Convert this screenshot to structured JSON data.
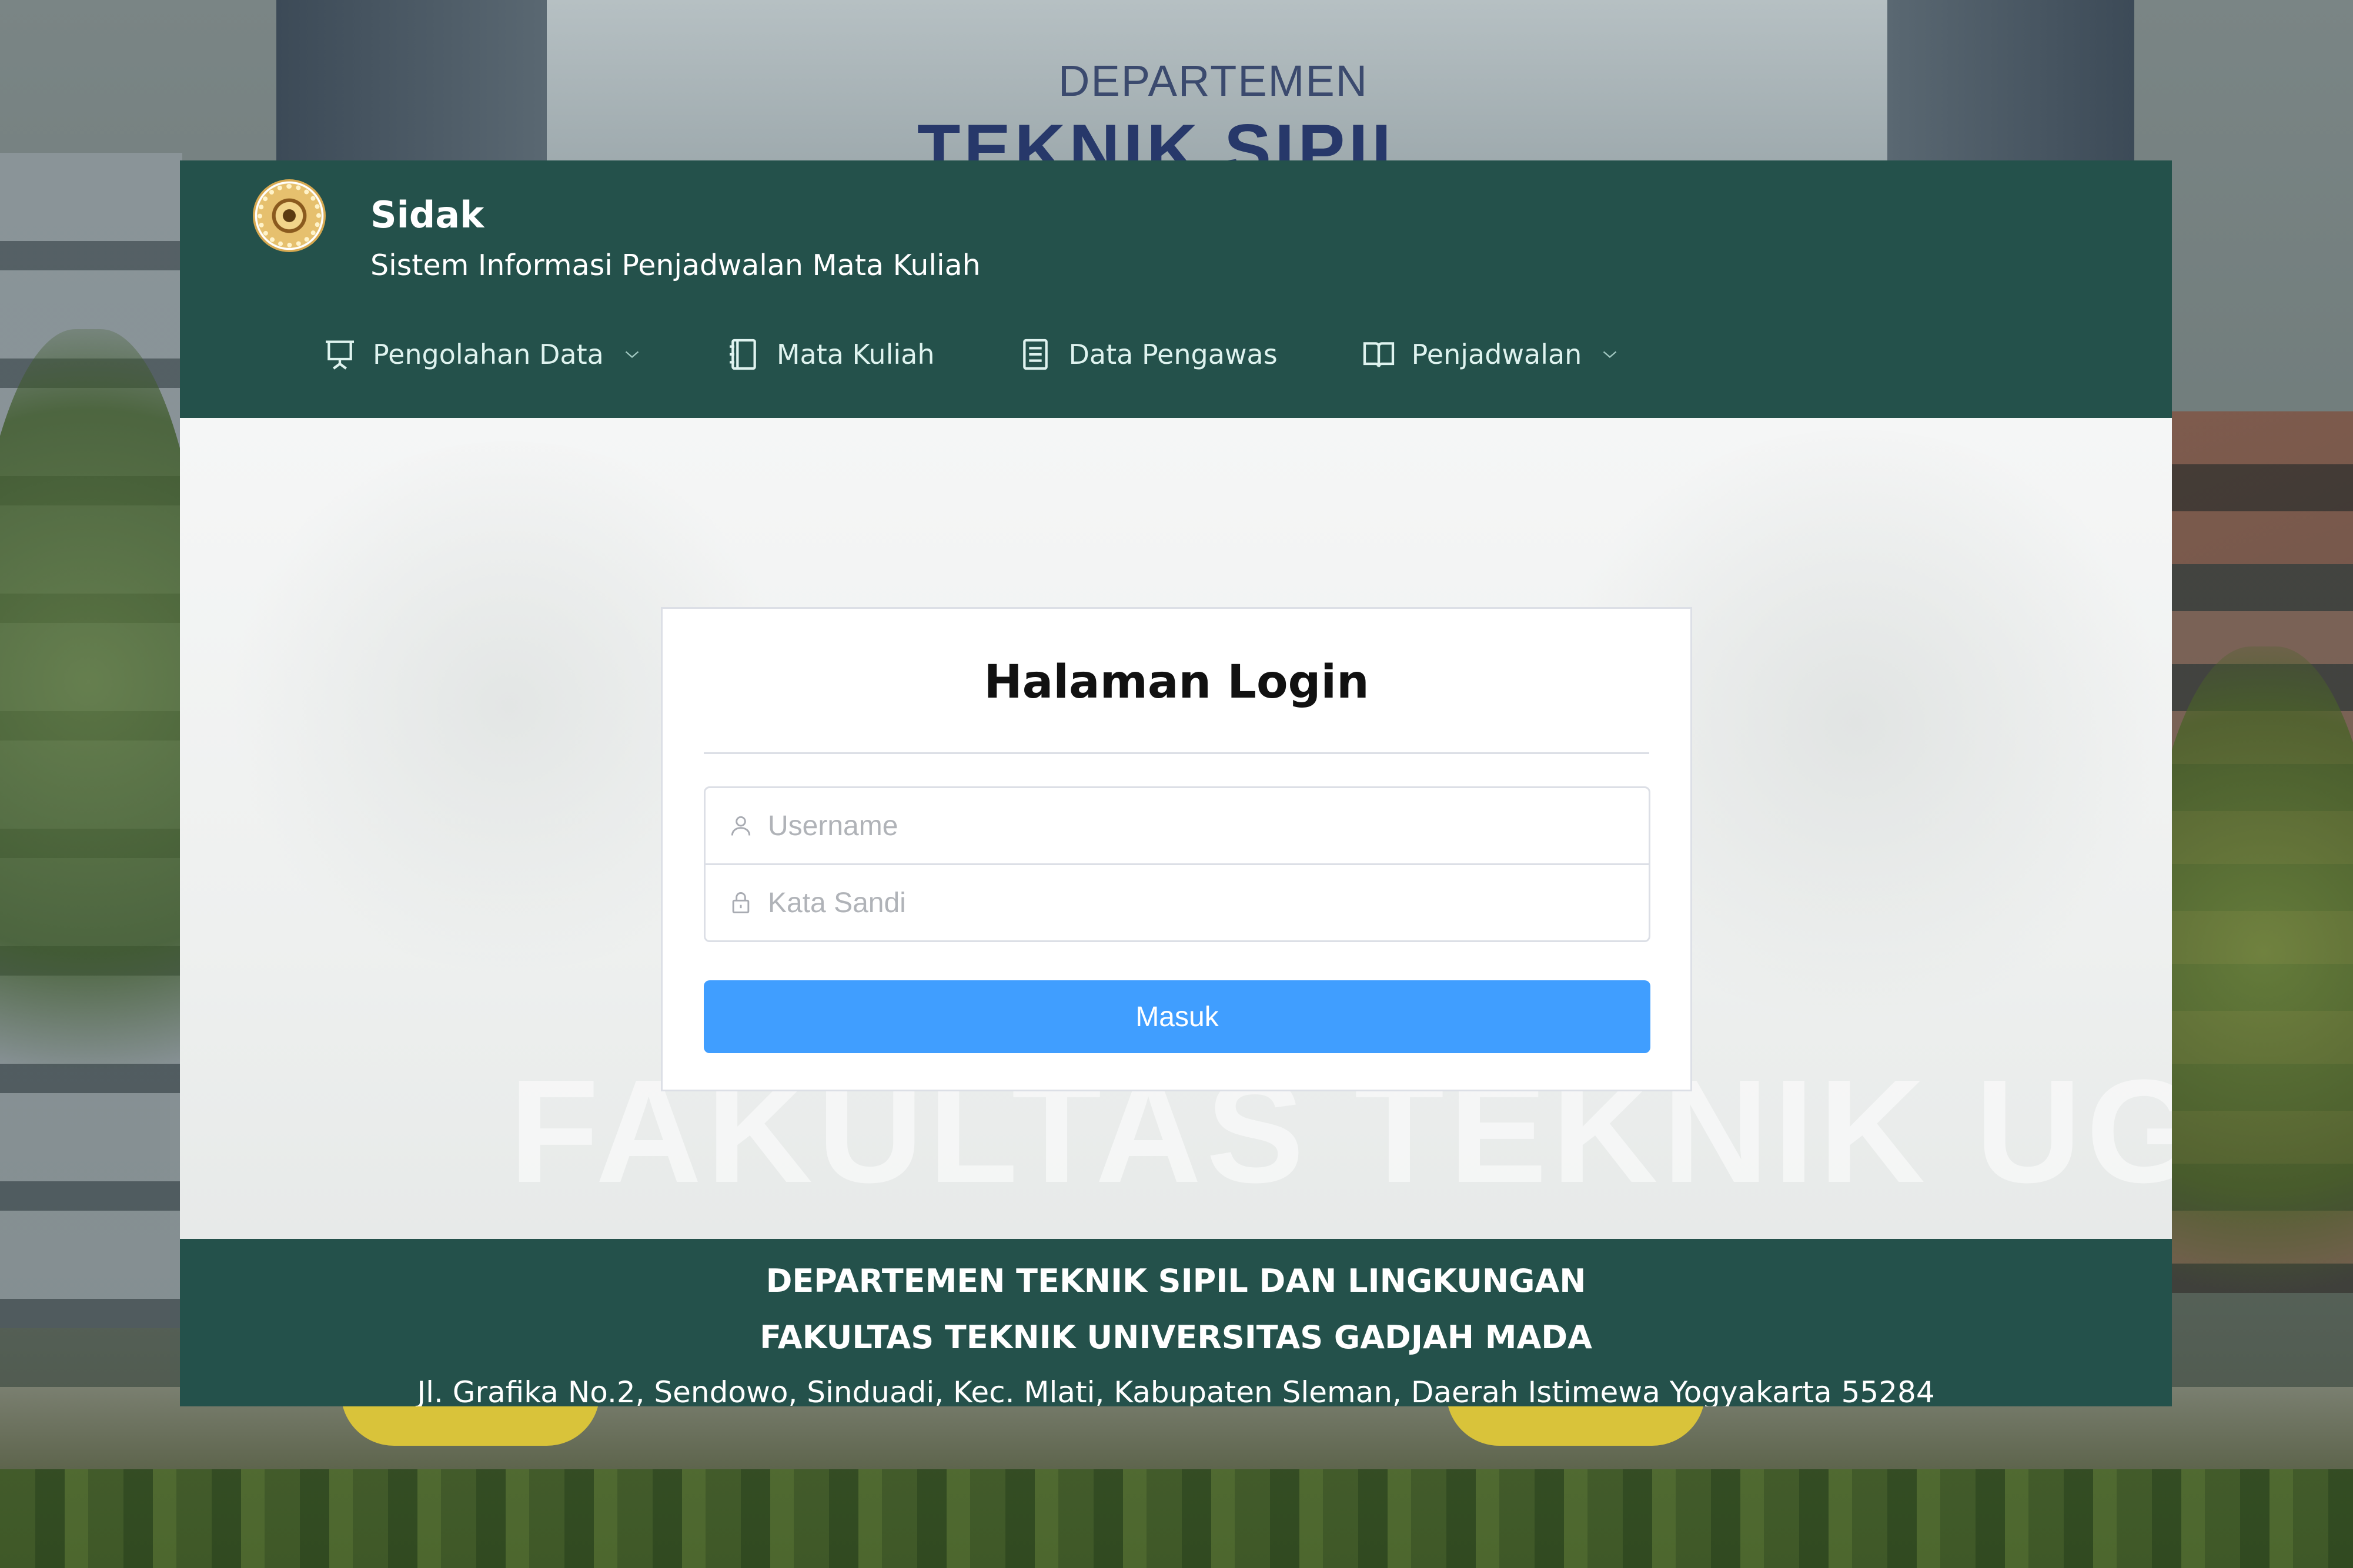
{
  "background": {
    "sign_line1": "DEPARTEMEN",
    "sign_line2": "TEKNIK SIPIL",
    "ghost_text": "FAKULTAS TEKNIK UGM"
  },
  "header": {
    "title": "Sidak",
    "subtitle": "Sistem Informasi Penjadwalan Mata Kuliah",
    "nav": [
      {
        "label": "Pengolahan Data",
        "icon": "presentation-icon",
        "dropdown": true
      },
      {
        "label": "Mata Kuliah",
        "icon": "notebook-icon",
        "dropdown": false
      },
      {
        "label": "Data Pengawas",
        "icon": "document-list-icon",
        "dropdown": false
      },
      {
        "label": "Penjadwalan",
        "icon": "open-book-icon",
        "dropdown": true
      }
    ]
  },
  "login": {
    "title": "Halaman Login",
    "username_placeholder": "Username",
    "password_placeholder": "Kata Sandi",
    "submit_label": "Masuk"
  },
  "footer": {
    "line1": "DEPARTEMEN TEKNIK SIPIL DAN LINGKUNGAN",
    "line2": "FAKULTAS TEKNIK UNIVERSITAS GADJAH MADA",
    "line3": "Jl. Grafika No.2, Sendowo, Sinduadi, Kec. Mlati, Kabupaten Sleman, Daerah Istimewa Yogyakarta 55284"
  },
  "colors": {
    "header_bg": "#24514b",
    "accent_button": "#409eff",
    "nav_text": "#dff3ef"
  }
}
